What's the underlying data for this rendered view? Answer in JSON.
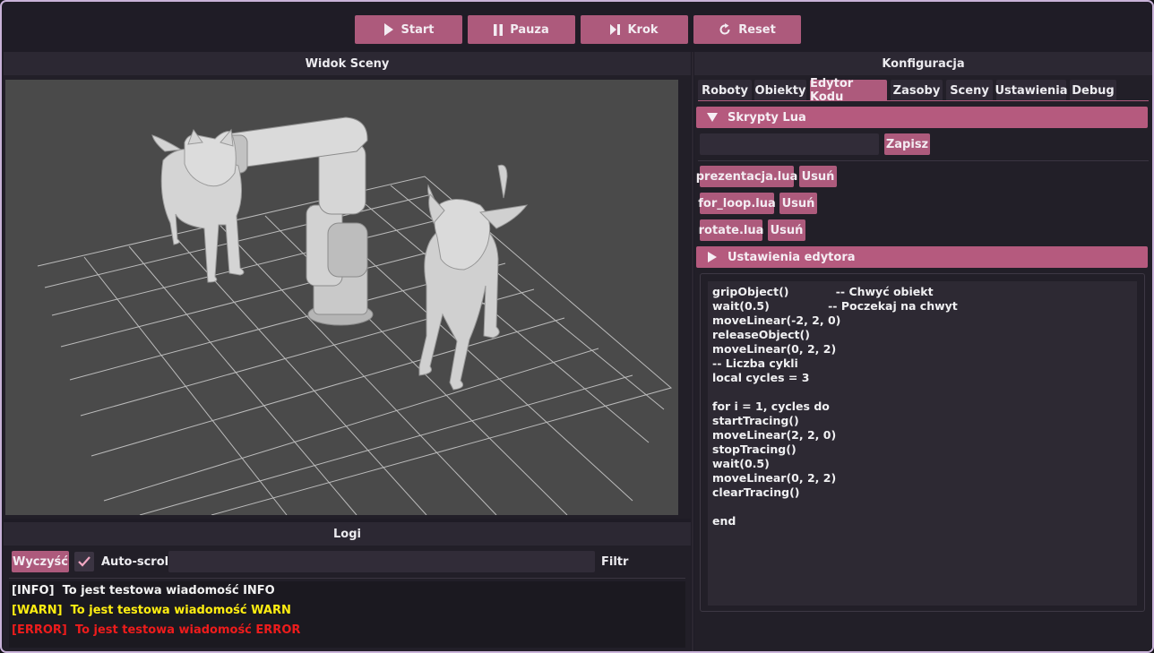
{
  "toolbar": {
    "start_label": "Start",
    "pause_label": "Pauza",
    "step_label": "Krok",
    "reset_label": "Reset"
  },
  "scene": {
    "title": "Widok Sceny"
  },
  "logs": {
    "title": "Logi",
    "clear_label": "Wyczyść",
    "autoscroll_label": "Auto-scroll",
    "autoscroll_checked": true,
    "filter_value": "",
    "filter_label": "Filtr",
    "entries": [
      {
        "level": "[INFO]",
        "message": "To jest testowa wiadomość INFO"
      },
      {
        "level": "[WARN]",
        "message": "To jest testowa wiadomość WARN"
      },
      {
        "level": "[ERROR]",
        "message": "To jest testowa wiadomość ERROR"
      }
    ]
  },
  "config": {
    "title": "Konfiguracja",
    "tabs": [
      "Roboty",
      "Obiekty",
      "Edytor Kodu",
      "Zasoby",
      "Sceny",
      "Ustawienia",
      "Debug"
    ],
    "active_tab": "Edytor Kodu",
    "scripts_section": "Skrypty Lua",
    "new_script_value": "",
    "save_label": "Zapisz",
    "scripts": [
      {
        "name": "prezentacja.lua",
        "delete_label": "Usuń"
      },
      {
        "name": "for_loop.lua",
        "delete_label": "Usuń"
      },
      {
        "name": "rotate.lua",
        "delete_label": "Usuń"
      }
    ],
    "editor_settings_section": "Ustawienia edytora",
    "code_lines": [
      "gripObject()            -- Chwyć obiekt",
      "wait(0.5)               -- Poczekaj na chwyt",
      "moveLinear(-2, 2, 0)",
      "releaseObject()",
      "moveLinear(0, 2, 2)",
      "-- Liczba cykli",
      "local cycles = 3",
      "",
      "for i = 1, cycles do",
      "startTracing()",
      "moveLinear(2, 2, 0)",
      "stopTracing()",
      "wait(0.5)",
      "moveLinear(0, 2, 2)",
      "clearTracing()",
      "",
      "end"
    ]
  },
  "colors": {
    "accent": "#ad5a7c",
    "background": "#1f1c26",
    "border": "#c9b3d9",
    "log_info": "#f2f2f2",
    "log_warn": "#ffee11",
    "log_error": "#ee1c1c",
    "viewport": "#4a4a4a"
  },
  "icons": {
    "start": "play-icon",
    "pause": "pause-icon",
    "step": "step-forward-icon",
    "reset": "reset-icon",
    "expanded": "triangle-down-icon",
    "collapsed": "triangle-right-icon",
    "check": "checkmark-icon"
  }
}
